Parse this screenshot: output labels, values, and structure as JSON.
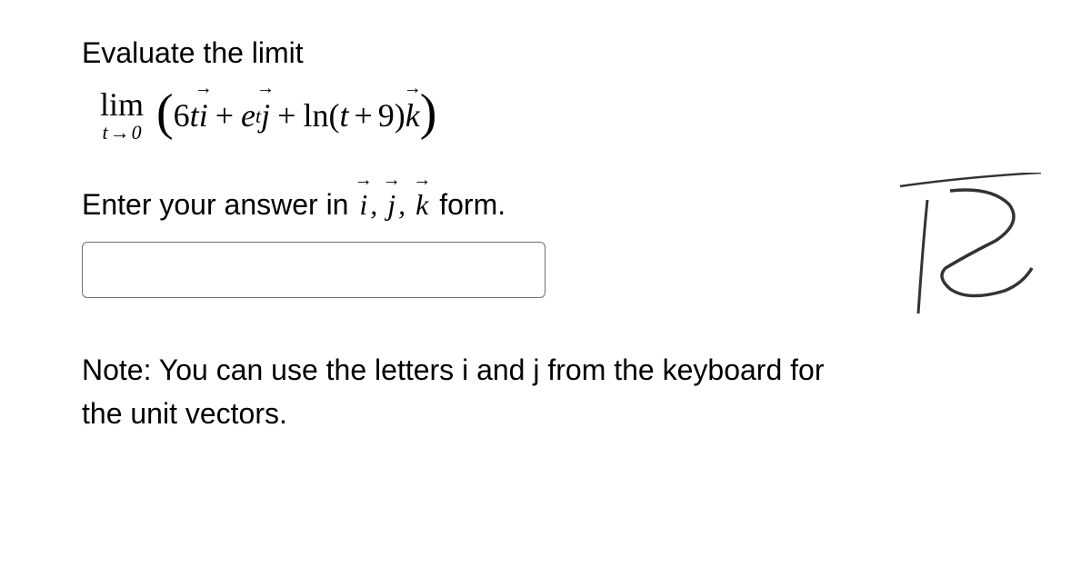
{
  "question": {
    "heading": "Evaluate the limit",
    "limit_label": "lim",
    "limit_var": "t",
    "limit_arrow": "→",
    "limit_target": "0",
    "expression": {
      "coef1": "6",
      "var1": "t",
      "vec1": "i",
      "plus1": "+",
      "base2": "e",
      "exp2": "t",
      "vec2": "j",
      "plus2": "+",
      "func3": "ln",
      "lpar3": "(",
      "inner3a": "t",
      "plus3": "+",
      "inner3b": "9",
      "rpar3": ")",
      "vec3": "k"
    }
  },
  "instruction": {
    "prefix": "Enter your answer in ",
    "vec_i": "i",
    "comma1": ", ",
    "vec_j": "j",
    "comma2": ", ",
    "vec_k": "k",
    "suffix": " form."
  },
  "answer": {
    "value": "",
    "placeholder": ""
  },
  "note": {
    "text": "Note: You can use the letters i and j from the keyboard for the unit vectors."
  }
}
